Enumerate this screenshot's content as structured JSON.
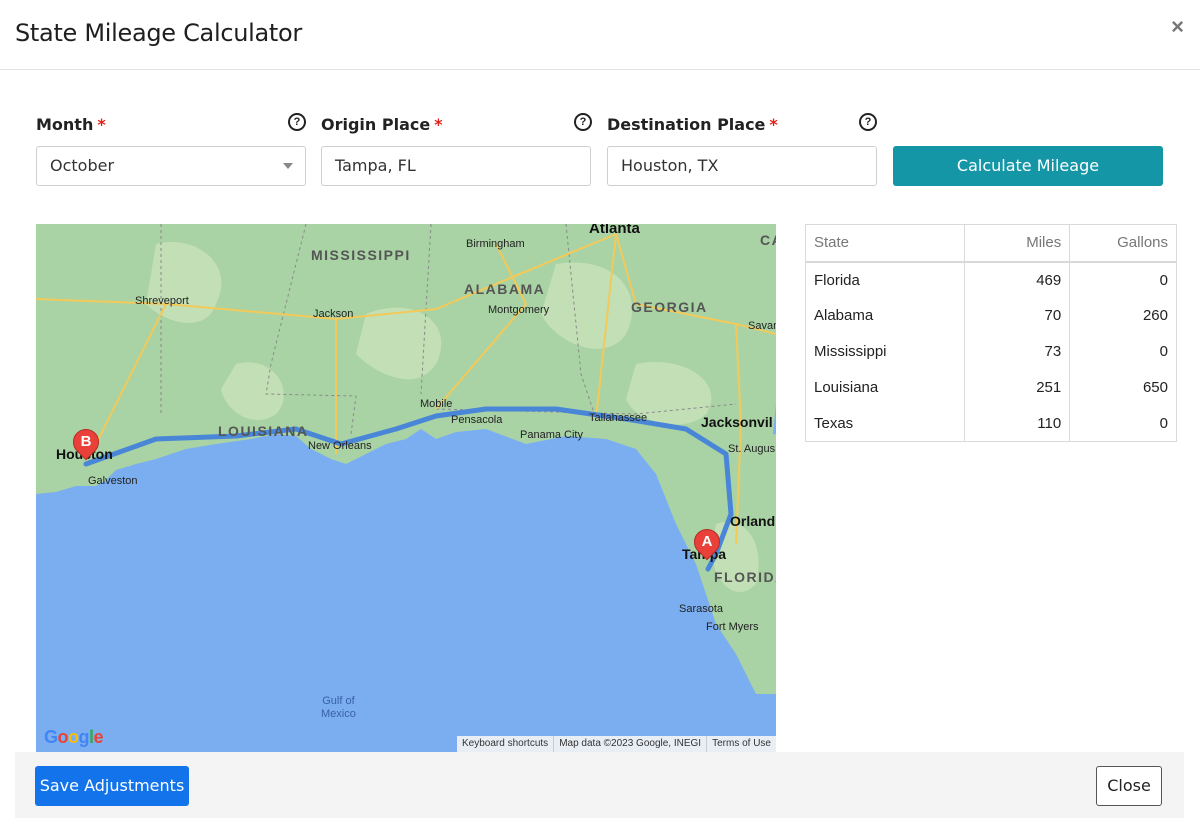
{
  "modal": {
    "title": "State Mileage Calculator",
    "close_icon": "×"
  },
  "form": {
    "month": {
      "label": "Month",
      "required_mark": "*",
      "value": "October",
      "help_icon": "?"
    },
    "origin": {
      "label": "Origin Place",
      "required_mark": "*",
      "value": "Tampa, FL",
      "help_icon": "?"
    },
    "destination": {
      "label": "Destination Place",
      "required_mark": "*",
      "value": "Houston, TX",
      "help_icon": "?"
    },
    "calculate_label": "Calculate Mileage"
  },
  "map": {
    "state_labels": {
      "mississippi": "MISSISSIPPI",
      "alabama": "ALABAMA",
      "georgia": "GEORGIA",
      "louisiana": "LOUISIANA",
      "florida": "FLORIDA"
    },
    "city_labels": {
      "atlanta": "Atlanta",
      "birmingham": "Birmingham",
      "shreveport": "Shreveport",
      "jackson": "Jackson",
      "montgomery": "Montgomery",
      "savannah": "Savan",
      "mobile": "Mobile",
      "pensacola": "Pensacola",
      "tallahassee": "Tallahassee",
      "jacksonville": "Jacksonvil",
      "st_augustine": "St. Augus",
      "new_orleans": "New Orleans",
      "panama_city": "Panama City",
      "houston": "Houston",
      "galveston": "Galveston",
      "orlando": "Orland",
      "tampa": "Tampa",
      "sarasota": "Sarasota",
      "fort_myers": "Fort Myers",
      "ca": "CA"
    },
    "water_label": "Gulf of\nMexico",
    "marker_a": "A",
    "marker_b": "B",
    "google_logo": "Google",
    "attribution": {
      "shortcuts": "Keyboard shortcuts",
      "data": "Map data ©2023 Google, INEGI",
      "terms": "Terms of Use"
    },
    "colors": {
      "land": "#a9d3a4",
      "water": "#7aaef0",
      "route": "#4a86d8",
      "marker": "#e9403a"
    }
  },
  "table": {
    "headers": [
      "State",
      "Miles",
      "Gallons"
    ],
    "rows": [
      {
        "state": "Florida",
        "miles": "469",
        "gallons": "0"
      },
      {
        "state": "Alabama",
        "miles": "70",
        "gallons": "260"
      },
      {
        "state": "Mississippi",
        "miles": "73",
        "gallons": "0"
      },
      {
        "state": "Louisiana",
        "miles": "251",
        "gallons": "650"
      },
      {
        "state": "Texas",
        "miles": "110",
        "gallons": "0"
      }
    ]
  },
  "footer": {
    "save_label": "Save Adjustments",
    "close_label": "Close"
  }
}
